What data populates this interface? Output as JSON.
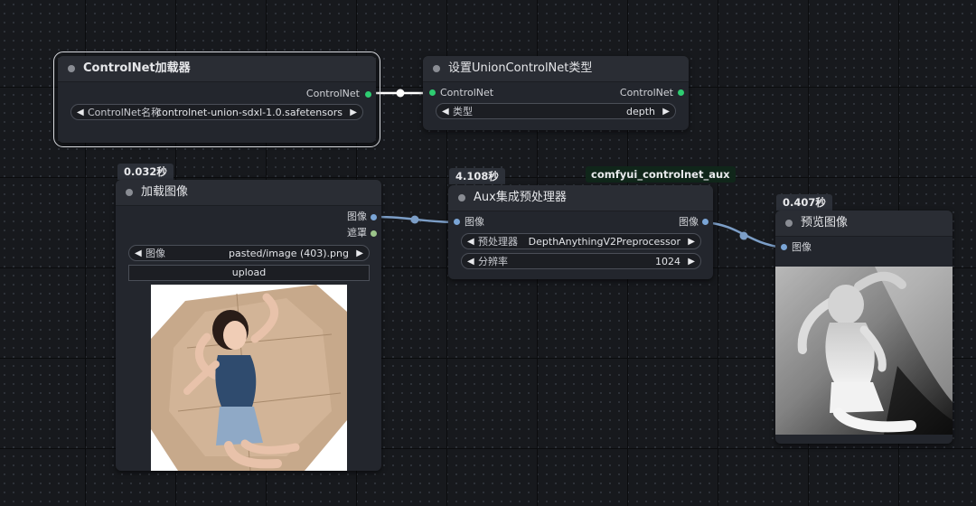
{
  "nodes": {
    "controlnet_loader": {
      "title": "ControlNet加载器",
      "output_label": "ControlNet",
      "widget_label": "ControlNet名称",
      "widget_value": "controlnet-union-sdxl-1.0.safetensors"
    },
    "set_union_type": {
      "title": "设置UnionControlNet类型",
      "input_label": "ControlNet",
      "output_label": "ControlNet",
      "widget_label": "类型",
      "widget_value": "depth"
    },
    "load_image": {
      "timer": "0.032秒",
      "title": "加载图像",
      "output_image_label": "图像",
      "output_mask_label": "遮罩",
      "widget_label": "图像",
      "widget_value": "pasted/image (403).png",
      "upload_label": "upload"
    },
    "aux_preprocessor": {
      "timer": "4.108秒",
      "badge": "comfyui_controlnet_aux",
      "title": "Aux集成预处理器",
      "input_label": "图像",
      "output_label": "图像",
      "widget1_label": "预处理器",
      "widget1_value": "DepthAnythingV2Preprocessor",
      "widget2_label": "分辨率",
      "widget2_value": "1024"
    },
    "preview_image": {
      "timer": "0.407秒",
      "title": "预览图像",
      "input_label": "图像"
    }
  },
  "icons": {
    "widget_left": "◀",
    "widget_right": "▶"
  },
  "colors": {
    "controlnet_slot": "#2ecc71",
    "image_slot": "#7aa5d6",
    "mask_slot": "#9bc48a",
    "link_image": "#7c9ec7",
    "link_controlnet": "#ffffff"
  }
}
